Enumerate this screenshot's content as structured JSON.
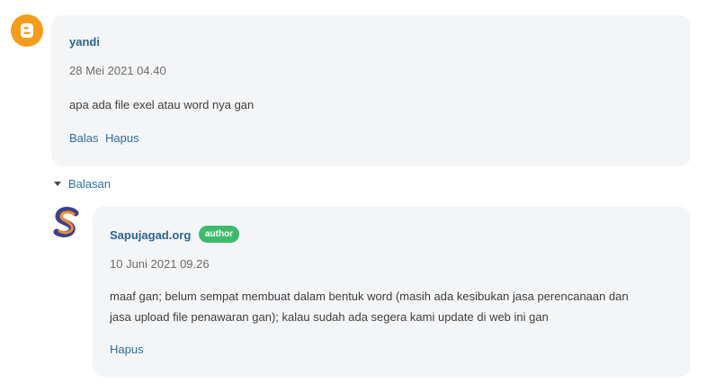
{
  "comment": {
    "author": "yandi",
    "date": "28 Mei 2021 04.40",
    "text": "apa ada file exel atau word nya gan",
    "actions": {
      "reply": "Balas",
      "delete": "Hapus"
    },
    "avatar_icon": "blogger-icon",
    "avatar_color": "#f59c1a"
  },
  "replies_toggle": "Balasan",
  "reply": {
    "author": "Sapujagad.org",
    "badge": "author",
    "badge_color": "#3dbb6c",
    "date": "10 Juni 2021 09.26",
    "text_line1": "maaf gan; belum sempat membuat dalam bentuk word (masih ada kesibukan jasa perencanaan dan",
    "text_line2": "jasa upload file penawaran gan); kalau sudah ada segera kami update di web ini gan",
    "actions": {
      "delete": "Hapus"
    },
    "avatar_icon": "sapujagad-logo-icon"
  }
}
